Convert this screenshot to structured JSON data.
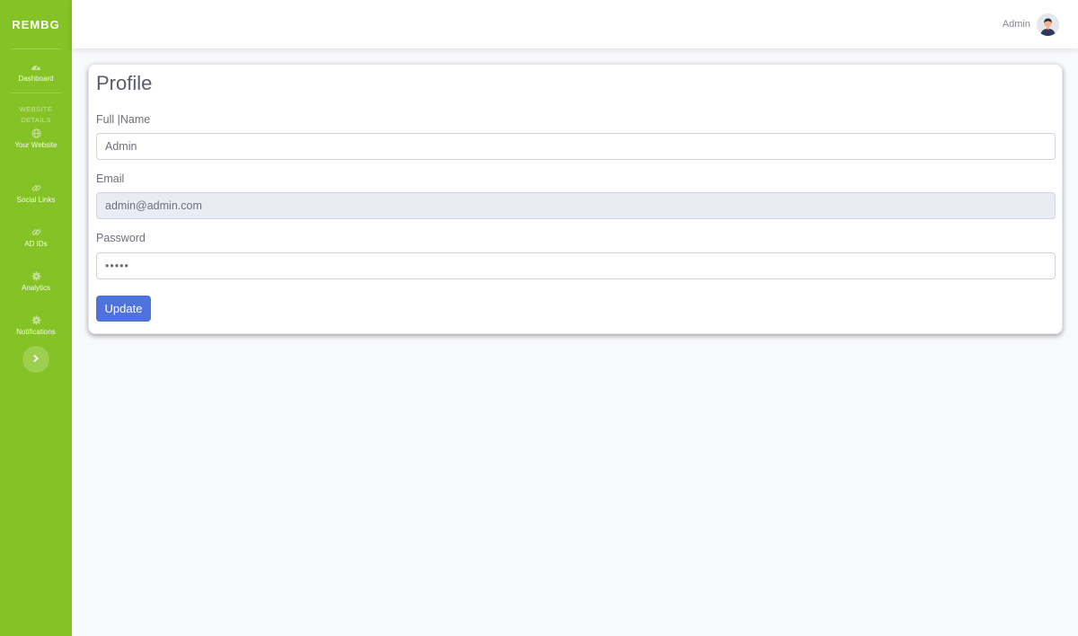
{
  "sidebar": {
    "brand": "REMBG",
    "items": [
      {
        "label": "Dashboard",
        "icon": "dashboard-icon"
      },
      {
        "label": "Your Website",
        "icon": "globe-icon"
      },
      {
        "label": "Social Links",
        "icon": "link-icon"
      },
      {
        "label": "AD IDs",
        "icon": "link-icon"
      },
      {
        "label": "Analytics",
        "icon": "gear-icon"
      },
      {
        "label": "Notifications",
        "icon": "gear-icon"
      }
    ],
    "section_heading_line1": "WEBSITE",
    "section_heading_line2": "DETAILS",
    "toggle_icon": "chevron-right-icon",
    "color": "#84c225"
  },
  "topbar": {
    "user_name": "Admin",
    "avatar_icon": "user-avatar"
  },
  "profile": {
    "title": "Profile",
    "fields": [
      {
        "label": "Full |Name",
        "value": "Admin"
      },
      {
        "label": "Email",
        "value": "admin@admin.com"
      },
      {
        "label": "Password",
        "value": "•••••"
      }
    ],
    "button_label": "Update",
    "button_color": "#4e73df"
  }
}
